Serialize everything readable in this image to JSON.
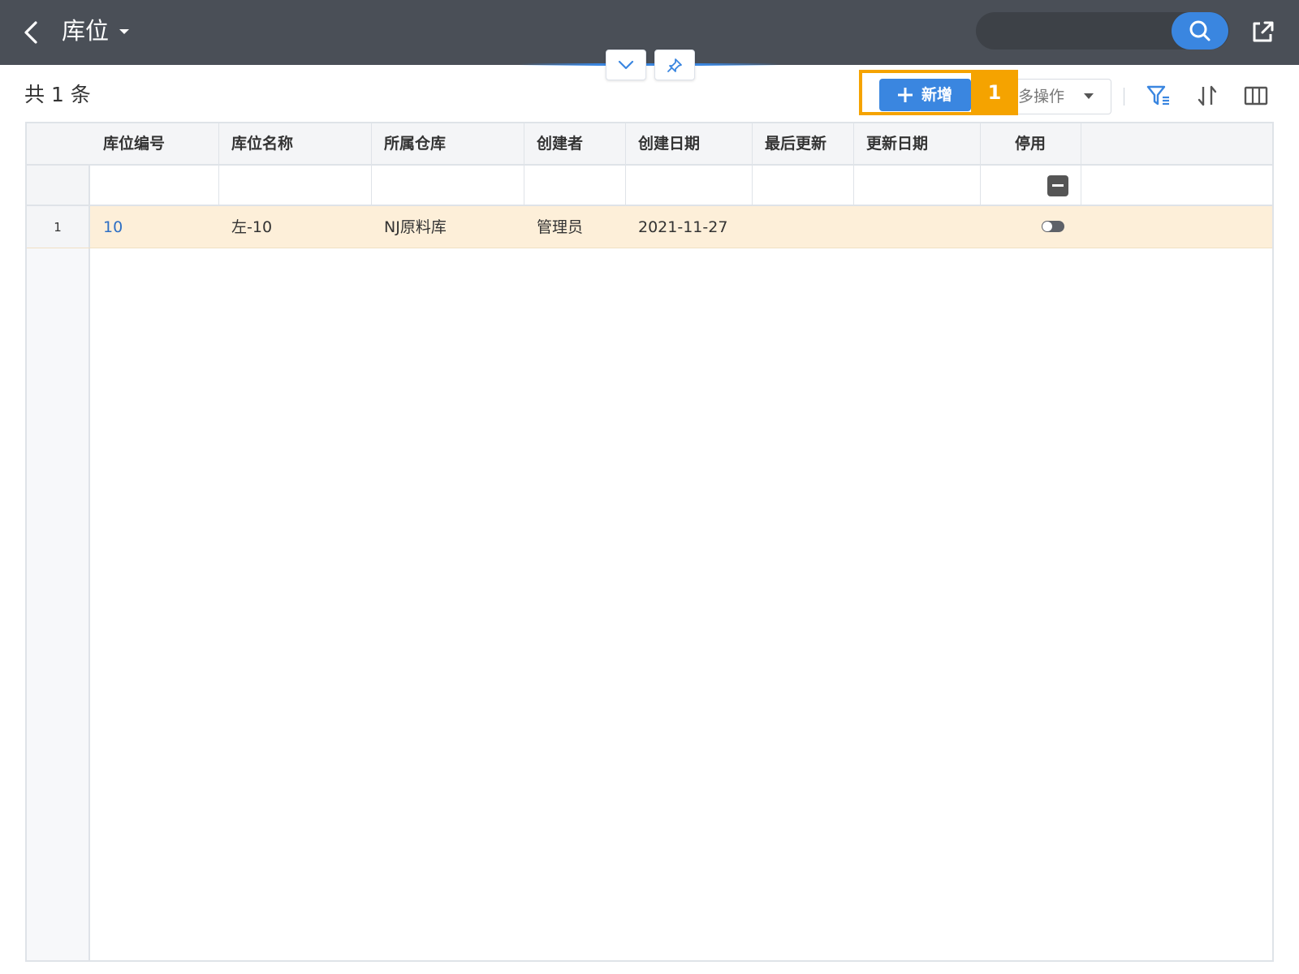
{
  "header": {
    "title": "库位",
    "colors": {
      "bar": "#4a4f57",
      "accent": "#3a86e0"
    },
    "icons": [
      "chevron-left-icon",
      "caret-down-icon",
      "search-icon",
      "share-icon",
      "chevron-down-icon",
      "pin-icon"
    ]
  },
  "toolbar": {
    "count_text": "共 1 条",
    "add_label": "新增",
    "badge": "1",
    "more_label": "多操作",
    "highlight_color": "#f5a300",
    "icons": [
      "filter-icon",
      "sort-icon",
      "columns-icon"
    ]
  },
  "table": {
    "columns": [
      "库位编号",
      "库位名称",
      "所属仓库",
      "创建者",
      "创建日期",
      "最后更新",
      "更新日期",
      "停用"
    ],
    "rows": [
      {
        "index": "1",
        "code": "10",
        "name": "左-10",
        "warehouse": "NJ原料库",
        "creator": "管理员",
        "created": "2021-11-27",
        "last_update": "",
        "update_date": "",
        "disabled": false
      }
    ],
    "row_highlight_color": "#fdefd9"
  }
}
